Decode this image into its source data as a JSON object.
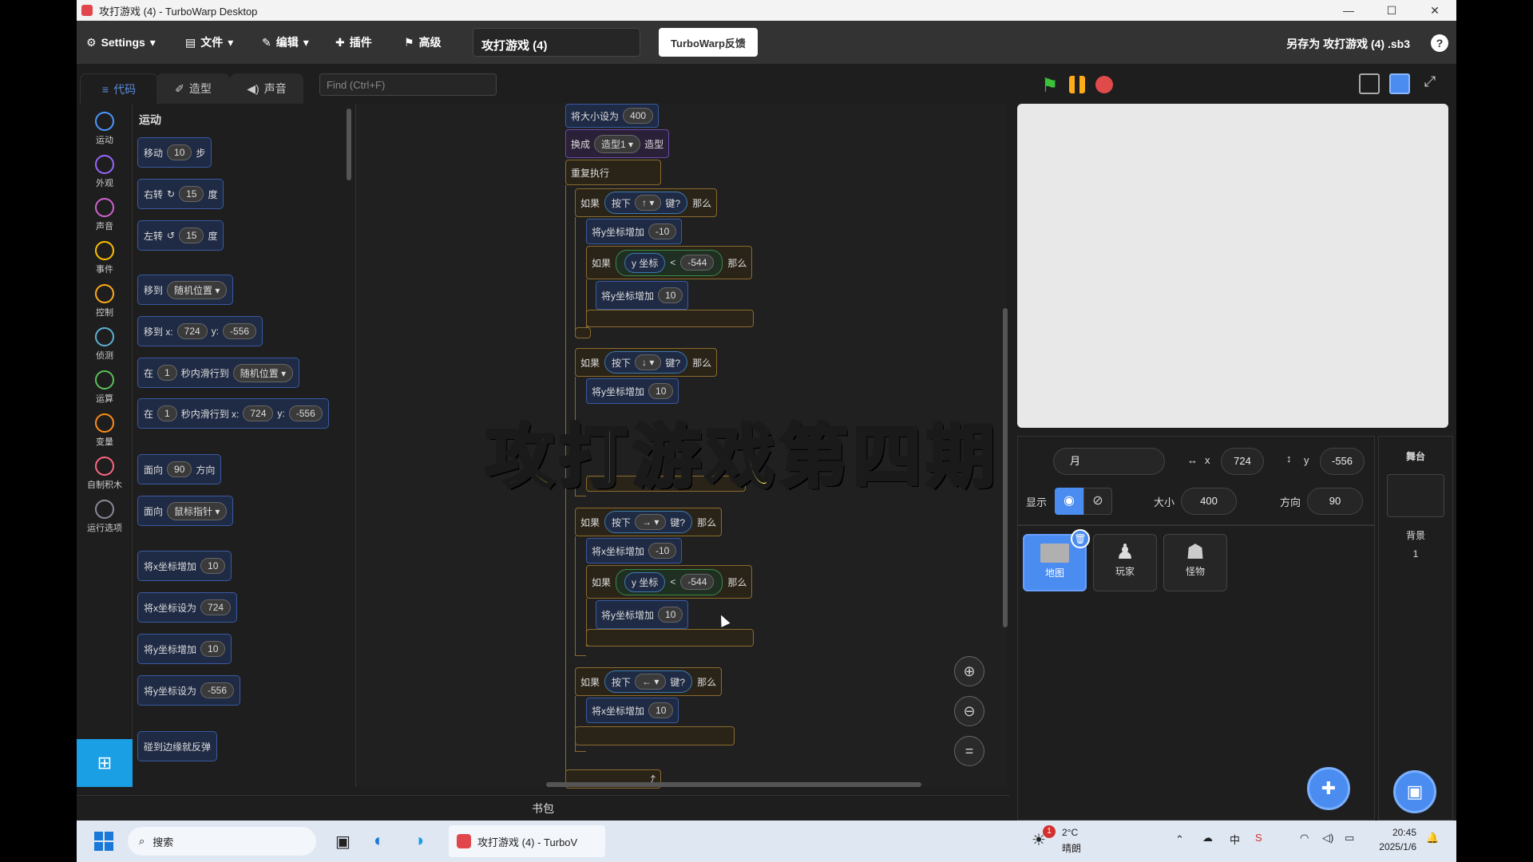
{
  "window": {
    "title": "攻打游戏 (4) - TurboWarp Desktop",
    "controls": [
      "—",
      "☐",
      "✕"
    ]
  },
  "menubar": {
    "settings": "Settings",
    "file": "文件",
    "edit": "编辑",
    "addons": "插件",
    "advanced": "高级",
    "project_title": "攻打游戏 (4)",
    "feedback": "TurboWarp反馈",
    "save_as": "另存为 攻打游戏 (4) .sb3",
    "help": "?"
  },
  "tabs": {
    "code": "代码",
    "costumes": "造型",
    "sounds": "声音"
  },
  "find": {
    "placeholder": "Find (Ctrl+F)"
  },
  "categories": [
    {
      "label": "运动",
      "color": "#4c97ff"
    },
    {
      "label": "外观",
      "color": "#9966ff"
    },
    {
      "label": "声音",
      "color": "#cf63cf"
    },
    {
      "label": "事件",
      "color": "#ffbf00"
    },
    {
      "label": "控制",
      "color": "#ffab19"
    },
    {
      "label": "侦测",
      "color": "#5cb1d6"
    },
    {
      "label": "运算",
      "color": "#59c059"
    },
    {
      "label": "变量",
      "color": "#ff8c1a"
    },
    {
      "label": "自制积木",
      "color": "#ff6680"
    },
    {
      "label": "运行选项",
      "color": "#8a8a99"
    }
  ],
  "palette": {
    "title": "运动",
    "move": {
      "a": "移动",
      "v": "10",
      "b": "步"
    },
    "turn_right": {
      "a": "右转",
      "v": "15",
      "b": "度"
    },
    "turn_left": {
      "a": "左转",
      "v": "15",
      "b": "度"
    },
    "goto": {
      "a": "移到",
      "dd": "随机位置"
    },
    "goto_xy": {
      "a": "移到 x:",
      "x": "724",
      "b": "y:",
      "y": "-556"
    },
    "glide": {
      "a": "在",
      "v": "1",
      "b": "秒内滑行到",
      "dd": "随机位置"
    },
    "glide_xy": {
      "a": "在",
      "v": "1",
      "b": "秒内滑行到 x:",
      "x": "724",
      "c": "y:",
      "y": "-556"
    },
    "point_dir": {
      "a": "面向",
      "v": "90",
      "b": "方向"
    },
    "point_towards": {
      "a": "面向",
      "dd": "鼠标指针"
    },
    "change_x": {
      "a": "将x坐标增加",
      "v": "10"
    },
    "set_x": {
      "a": "将x坐标设为",
      "v": "724"
    },
    "change_y": {
      "a": "将y坐标增加",
      "v": "10"
    },
    "set_y": {
      "a": "将y坐标设为",
      "v": "-556"
    },
    "bounce": "碰到边缘就反弹"
  },
  "script": {
    "set_size": {
      "a": "将大小设为",
      "v": "400"
    },
    "switch_costume": {
      "a": "换成",
      "dd": "造型1",
      "b": "造型"
    },
    "forever": "重复执行",
    "if": "如果",
    "then": "那么",
    "key_pressed": "按下",
    "key_q": "键?",
    "key_up": "↑",
    "key_down": "↓",
    "key_right": "→",
    "key_left": "←",
    "change_y": "将y坐标增加",
    "change_x": "将x坐标增加",
    "y_pos": "y 坐标",
    "lt": "<",
    "val_m544": "-544",
    "v_m10": "-10",
    "v_10": "10"
  },
  "backpack": "书包",
  "overlay_title": "攻打游戏第四期",
  "sprite_info": {
    "name_partial": "月",
    "x_label": "x",
    "x": "724",
    "y_label": "y",
    "y": "-556",
    "show_label": "显示",
    "size_label": "大小",
    "size": "400",
    "dir_label": "方向",
    "dir": "90"
  },
  "sprites": [
    {
      "name": "地图"
    },
    {
      "name": "玩家"
    },
    {
      "name": "怪物"
    }
  ],
  "stage_panel": {
    "title": "舞台",
    "backdrop_label": "背景",
    "backdrop_count": "1"
  },
  "taskbar": {
    "search": "搜索",
    "app": "攻打游戏 (4) - TurboV",
    "weather_temp": "2°C",
    "weather_desc": "晴朗",
    "weather_badge": "1",
    "time": "20:45",
    "date": "2025/1/6"
  }
}
